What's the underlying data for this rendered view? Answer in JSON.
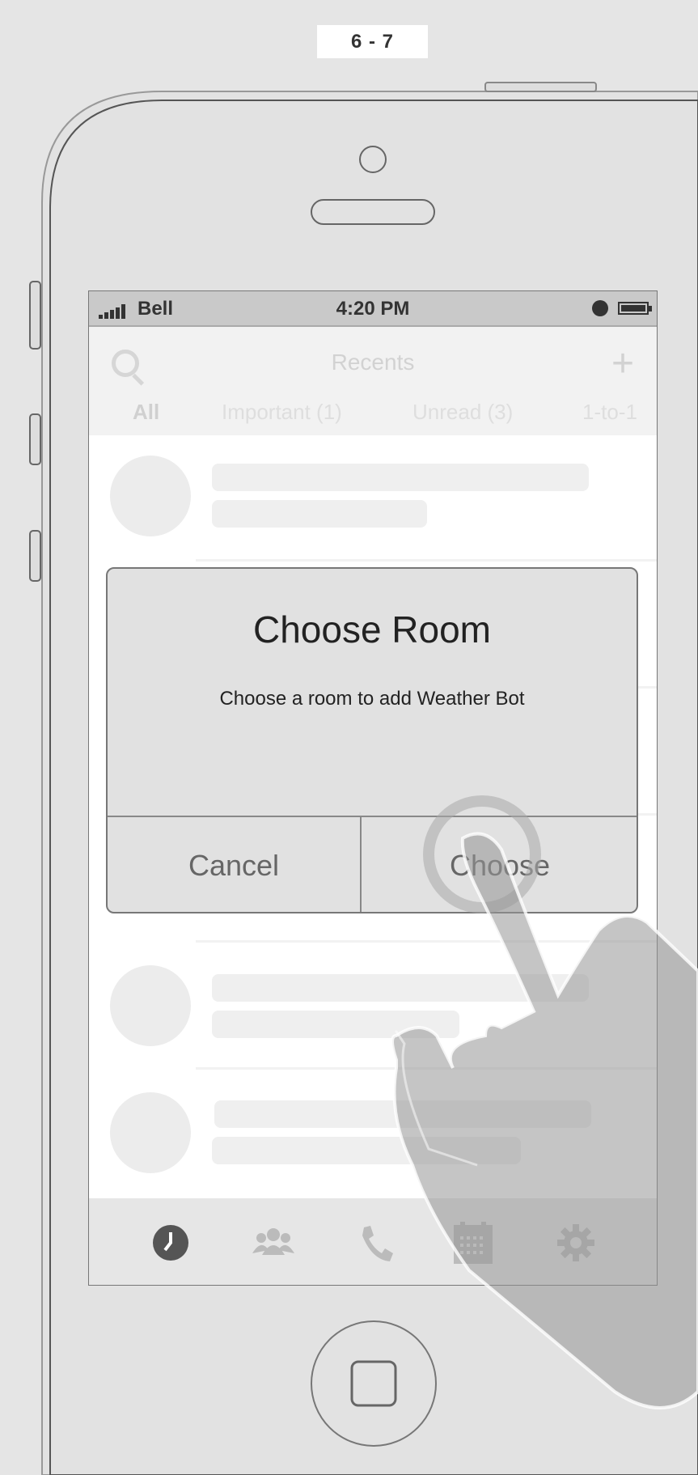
{
  "page_label": "6 - 7",
  "status_bar": {
    "carrier": "Bell",
    "time": "4:20 PM"
  },
  "header": {
    "title": "Recents",
    "search_icon": "search-icon",
    "add_icon": "plus-icon"
  },
  "filter_tabs": [
    {
      "label": "All",
      "active": true
    },
    {
      "label": "Important (1)",
      "active": false
    },
    {
      "label": "Unread (3)",
      "active": false
    },
    {
      "label": "1-to-1",
      "active": false
    }
  ],
  "dialog": {
    "title": "Choose Room",
    "message": "Choose a room to add Weather Bot",
    "cancel_label": "Cancel",
    "confirm_label": "Choose"
  },
  "tab_bar": {
    "items": [
      {
        "icon": "clock-icon",
        "active": true
      },
      {
        "icon": "people-icon",
        "active": false
      },
      {
        "icon": "phone-icon",
        "active": false
      },
      {
        "icon": "calendar-icon",
        "active": false
      },
      {
        "icon": "gear-icon",
        "active": false
      }
    ]
  },
  "colors": {
    "background": "#e5e5e5",
    "dialog": "#e1e1e1",
    "status_bar": "#c9c9c9"
  }
}
